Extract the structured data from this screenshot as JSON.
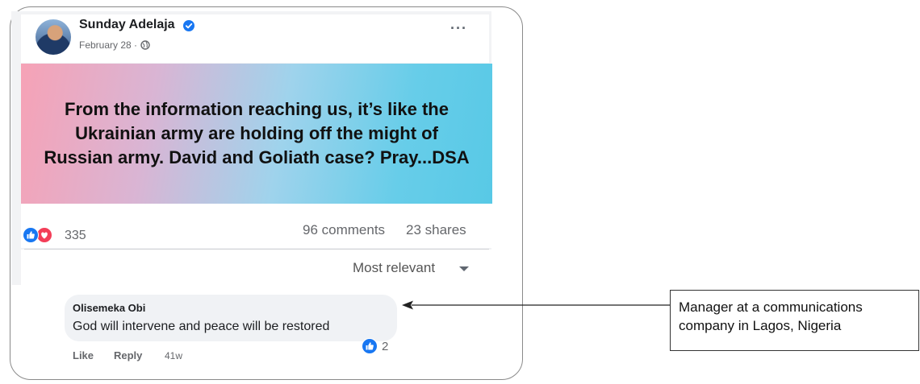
{
  "post": {
    "author": "Sunday Adelaja",
    "date": "February 28 ·",
    "more_label": "···",
    "banner_text": "From the information reaching us, it’s like the Ukrainian army are holding off the might of Russian army. David and Goliath case? Pray...DSA",
    "reaction_count": "335",
    "comments": "96 comments",
    "shares": "23 shares",
    "sort_label": "Most relevant",
    "icons": {
      "verified": "verified-badge-icon",
      "audience": "globe-icon",
      "reactions": [
        "like-icon",
        "love-icon"
      ]
    }
  },
  "comment": {
    "author": "Olisemeka Obi",
    "text": "God will intervene and peace will be restored",
    "like_label": "Like",
    "reply_label": "Reply",
    "time": "41w",
    "like_count": "2"
  },
  "annotation": {
    "text": "Manager at a communications company in Lagos, Nigeria"
  },
  "colors": {
    "accent": "#1877f2",
    "love": "#f33e58",
    "banner_left": "#f6a2b6",
    "banner_right": "#58c9e6"
  }
}
